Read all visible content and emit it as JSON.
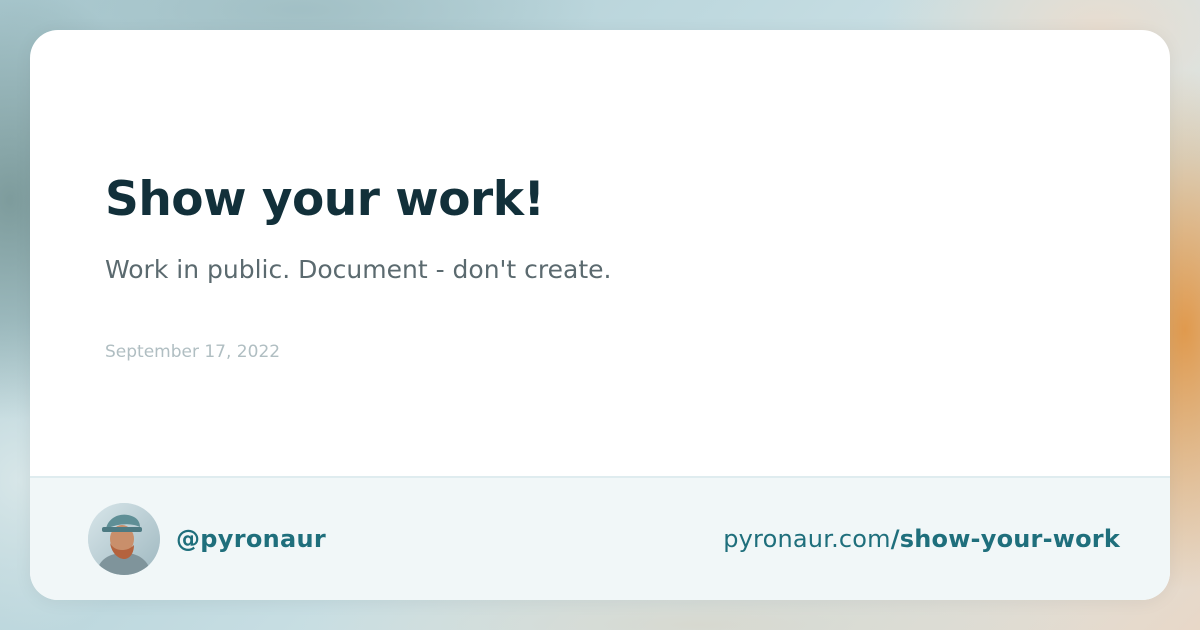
{
  "post": {
    "title": "Show your work!",
    "subtitle": "Work in public. Document - don't create.",
    "date": "September 17, 2022"
  },
  "author": {
    "handle": "@pyronaur",
    "avatar_icon": "avatar-photo"
  },
  "link": {
    "domain": "pyronaur.com",
    "path": "/show-your-work"
  },
  "colors": {
    "title": "#12303a",
    "subtitle": "#5b6a6f",
    "date": "#b0bec2",
    "accent": "#1f6f7c",
    "footer_bg": "#f1f7f8",
    "card_bg": "#ffffff"
  }
}
